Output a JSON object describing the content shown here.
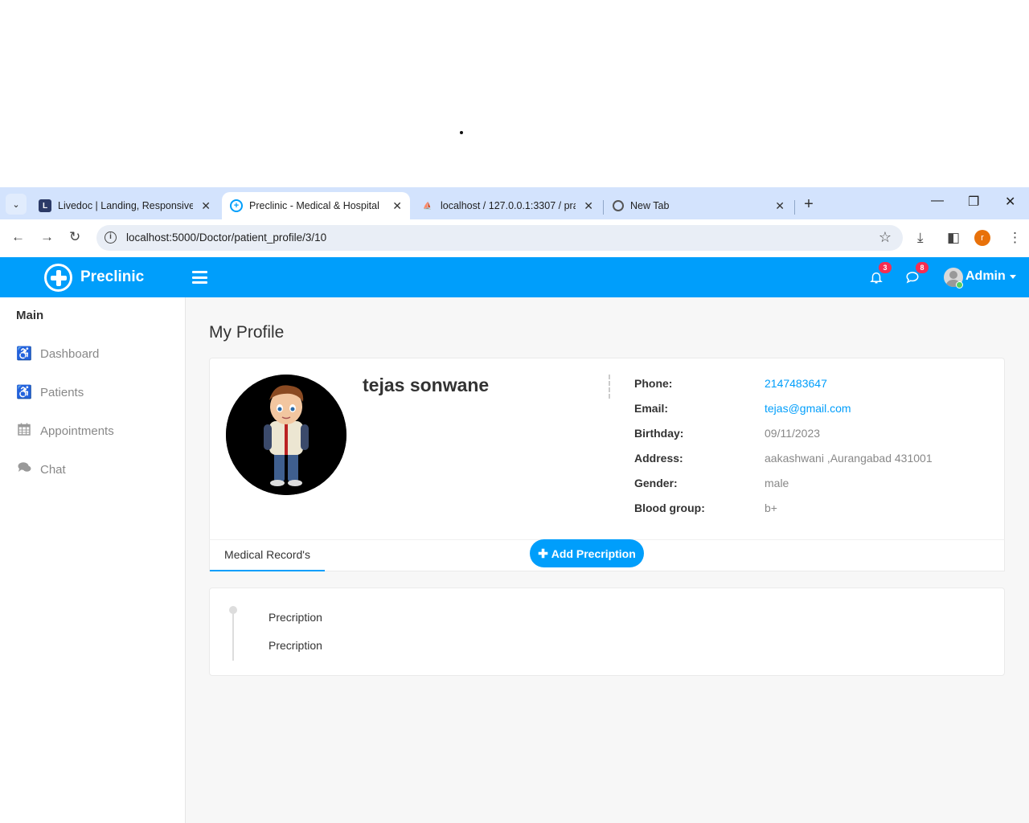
{
  "browser": {
    "tabs": [
      {
        "title": "Livedoc | Landing, Responsive",
        "favicon": "L"
      },
      {
        "title": "Preclinic - Medical & Hospital",
        "favicon": "plus-circle"
      },
      {
        "title": "localhost / 127.0.0.1:3307 / pra",
        "favicon": "pma"
      },
      {
        "title": "New Tab",
        "favicon": "chrome"
      }
    ],
    "url": "localhost:5000/Doctor/patient_profile/3/10",
    "profile_initial": "r"
  },
  "app": {
    "brand": "Preclinic",
    "notifications_count": "3",
    "messages_count": "8",
    "user_name": "Admin",
    "accent_color": "#009efb"
  },
  "sidebar": {
    "title": "Main",
    "items": [
      {
        "label": "Dashboard",
        "icon": "wheelchair-icon"
      },
      {
        "label": "Patients",
        "icon": "wheelchair-icon"
      },
      {
        "label": "Appointments",
        "icon": "calendar-icon"
      },
      {
        "label": "Chat",
        "icon": "comments-icon"
      }
    ]
  },
  "page": {
    "title": "My Profile",
    "patient_name": "tejas sonwane",
    "details": [
      {
        "label": "Phone:",
        "value": "2147483647"
      },
      {
        "label": "Email:",
        "value": "tejas@gmail.com"
      },
      {
        "label": "Birthday:",
        "value": "09/11/2023"
      },
      {
        "label": "Address:",
        "value": "aakashwani ,Aurangabad 431001"
      },
      {
        "label": "Gender:",
        "value": "male"
      },
      {
        "label": "Blood group:",
        "value": "b+"
      }
    ],
    "tab_label": "Medical Record's",
    "add_button_label": "Add Precription",
    "records": [
      "Precription",
      "Precription"
    ]
  }
}
